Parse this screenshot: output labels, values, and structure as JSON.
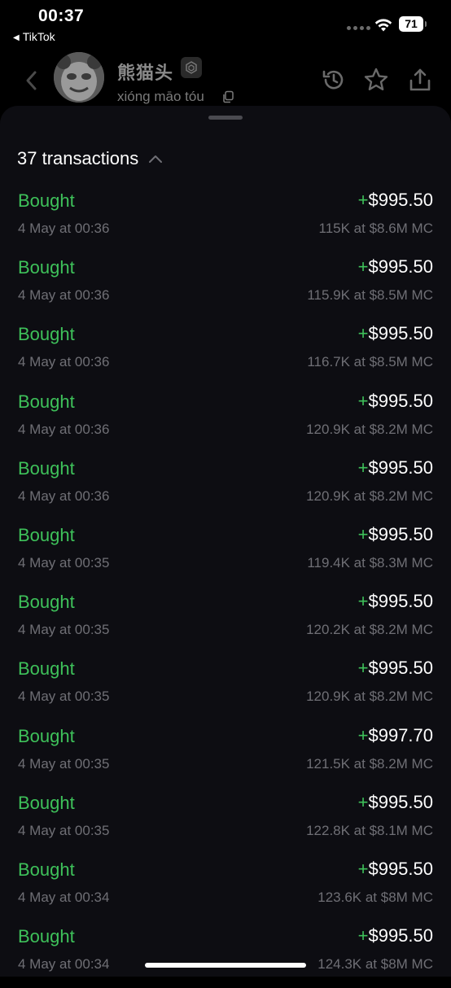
{
  "status_bar": {
    "time": "00:37",
    "back_app": "TikTok",
    "battery": "71"
  },
  "header": {
    "token_name": "熊猫头",
    "pinyin": "xióng māo tóu",
    "icons": [
      "back-chevron-icon",
      "history-icon",
      "star-icon",
      "share-icon",
      "chain-badge-icon",
      "copy-icon"
    ]
  },
  "sheet": {
    "transactions_count_label": "37 transactions",
    "transactions": [
      {
        "type": "Bought",
        "sign": "+",
        "amount": "$995.50",
        "time": "4 May at 00:36",
        "detail": "115K at $8.6M MC"
      },
      {
        "type": "Bought",
        "sign": "+",
        "amount": "$995.50",
        "time": "4 May at 00:36",
        "detail": "115.9K at $8.5M MC"
      },
      {
        "type": "Bought",
        "sign": "+",
        "amount": "$995.50",
        "time": "4 May at 00:36",
        "detail": "116.7K at $8.5M MC"
      },
      {
        "type": "Bought",
        "sign": "+",
        "amount": "$995.50",
        "time": "4 May at 00:36",
        "detail": "120.9K at $8.2M MC"
      },
      {
        "type": "Bought",
        "sign": "+",
        "amount": "$995.50",
        "time": "4 May at 00:36",
        "detail": "120.9K at $8.2M MC"
      },
      {
        "type": "Bought",
        "sign": "+",
        "amount": "$995.50",
        "time": "4 May at 00:35",
        "detail": "119.4K at $8.3M MC"
      },
      {
        "type": "Bought",
        "sign": "+",
        "amount": "$995.50",
        "time": "4 May at 00:35",
        "detail": "120.2K at $8.2M MC"
      },
      {
        "type": "Bought",
        "sign": "+",
        "amount": "$995.50",
        "time": "4 May at 00:35",
        "detail": "120.9K at $8.2M MC"
      },
      {
        "type": "Bought",
        "sign": "+",
        "amount": "$997.70",
        "time": "4 May at 00:35",
        "detail": "121.5K at $8.2M MC"
      },
      {
        "type": "Bought",
        "sign": "+",
        "amount": "$995.50",
        "time": "4 May at 00:35",
        "detail": "122.8K at $8.1M MC"
      },
      {
        "type": "Bought",
        "sign": "+",
        "amount": "$995.50",
        "time": "4 May at 00:34",
        "detail": "123.6K at $8M MC"
      },
      {
        "type": "Bought",
        "sign": "+",
        "amount": "$995.50",
        "time": "4 May at 00:34",
        "detail": "124.3K at $8M MC"
      }
    ]
  },
  "colors": {
    "background": "#000000",
    "sheet": "#0d0d12",
    "buy_green": "#3ec15a",
    "muted_text": "#6f6f75"
  }
}
